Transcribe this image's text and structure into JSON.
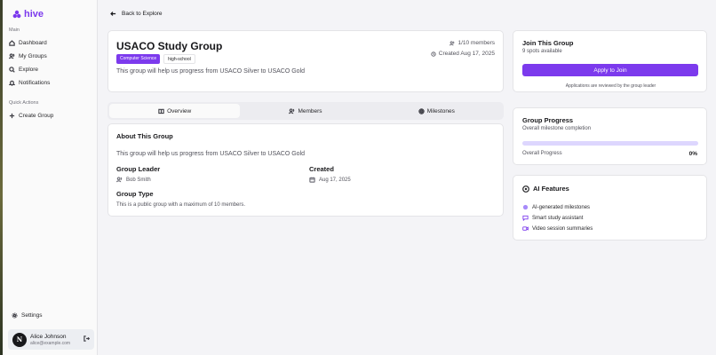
{
  "app": {
    "name": "hive"
  },
  "sidebar": {
    "main_label": "Main",
    "items": [
      {
        "label": "Dashboard",
        "icon": "home-icon"
      },
      {
        "label": "My Groups",
        "icon": "users-icon"
      },
      {
        "label": "Explore",
        "icon": "search-icon"
      },
      {
        "label": "Notifications",
        "icon": "bell-icon"
      }
    ],
    "quick_label": "Quick Actions",
    "create_label": "Create Group",
    "settings_label": "Settings",
    "user": {
      "initial": "N",
      "name": "Alice Johnson",
      "email": "alice@example.com"
    }
  },
  "back_label": "Back to Explore",
  "group": {
    "title": "USACO Study Group",
    "tags": [
      "Computer Science",
      "high-school"
    ],
    "description": "This group will help us progress from USACO Silver to USACO Gold",
    "members": "1/10 members",
    "created": "Created Aug 17, 2025"
  },
  "tabs": [
    "Overview",
    "Members",
    "Milestones"
  ],
  "about": {
    "title": "About This Group",
    "description": "This group will help us progress from USACO Silver to USACO Gold",
    "leader_label": "Group Leader",
    "leader": "Bob Smith",
    "created_label": "Created",
    "created": "Aug 17, 2025",
    "type_label": "Group Type",
    "type": "This is a public group with a maximum of 10 members."
  },
  "join": {
    "title": "Join This Group",
    "spots": "9 spots available",
    "button": "Apply to Join",
    "note": "Applications are reviewed by the group leader"
  },
  "progress": {
    "title": "Group Progress",
    "subtitle": "Overall milestone completion",
    "label": "Overall Progress",
    "value_text": "0%",
    "value": 0
  },
  "ai": {
    "title": "AI Features",
    "items": [
      "AI-generated milestones",
      "Smart study assistant",
      "Video session summaries"
    ]
  },
  "colors": {
    "accent": "#7c3aed",
    "accent_light": "#ddd6fe"
  }
}
